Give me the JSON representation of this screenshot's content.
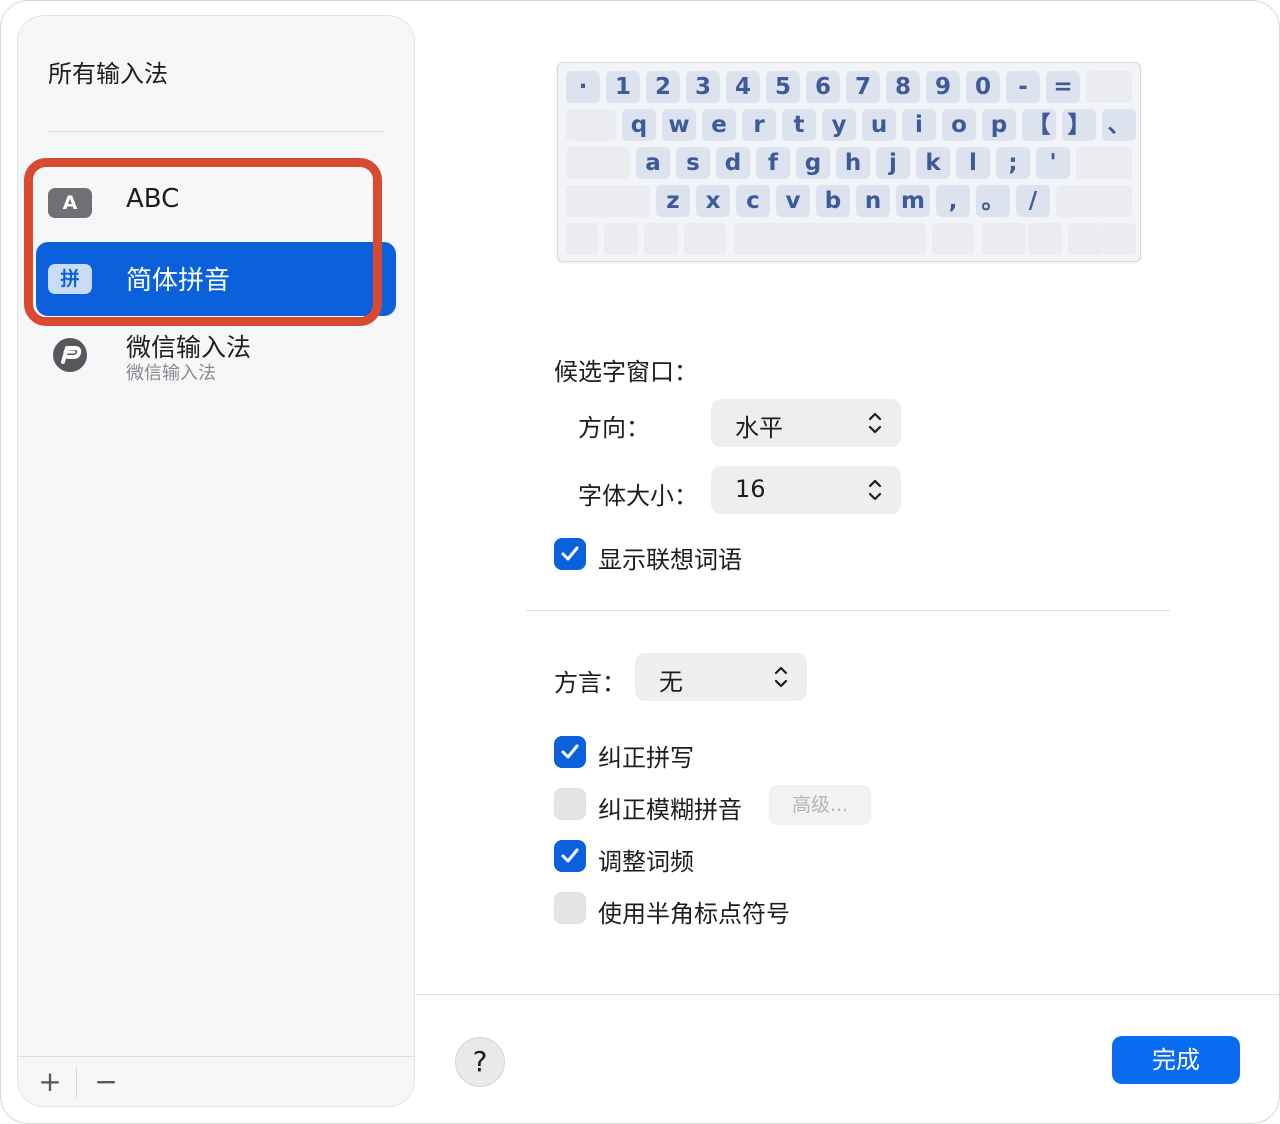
{
  "sidebar": {
    "title": "所有输入法",
    "items": [
      {
        "badge": "A",
        "label": "ABC"
      },
      {
        "badge": "拼",
        "label": "简体拼音"
      },
      {
        "label": "微信输入法",
        "sublabel": "微信输入法"
      }
    ],
    "add_label": "+",
    "remove_label": "−"
  },
  "keyboard": {
    "rows": [
      [
        "·",
        "1",
        "2",
        "3",
        "4",
        "5",
        "6",
        "7",
        "8",
        "9",
        "0",
        "-",
        "="
      ],
      [
        "q",
        "w",
        "e",
        "r",
        "t",
        "y",
        "u",
        "i",
        "o",
        "p",
        "【",
        "】",
        "、"
      ],
      [
        "a",
        "s",
        "d",
        "f",
        "g",
        "h",
        "j",
        "k",
        "l",
        ";",
        "'"
      ],
      [
        "z",
        "x",
        "c",
        "v",
        "b",
        "n",
        "m",
        ",",
        "。",
        "/"
      ]
    ]
  },
  "settings": {
    "candidate_window_label": "候选字窗口：",
    "direction_label": "方向：",
    "direction_value": "水平",
    "font_size_label": "字体大小：",
    "font_size_value": "16",
    "show_predictions_label": "显示联想词语",
    "show_predictions_checked": true,
    "dialect_label": "方言：",
    "dialect_value": "无",
    "correct_spelling_label": "纠正拼写",
    "correct_spelling_checked": true,
    "fuzzy_pinyin_label": "纠正模糊拼音",
    "fuzzy_pinyin_checked": false,
    "advanced_button_label": "高级...",
    "adjust_frequency_label": "调整词频",
    "adjust_frequency_checked": true,
    "half_width_punct_label": "使用半角标点符号",
    "half_width_punct_checked": false
  },
  "footer": {
    "help_label": "?",
    "done_label": "完成"
  },
  "colors": {
    "accent": "#0a61db",
    "highlight": "#d94a32",
    "key_text": "#3d5a99"
  }
}
